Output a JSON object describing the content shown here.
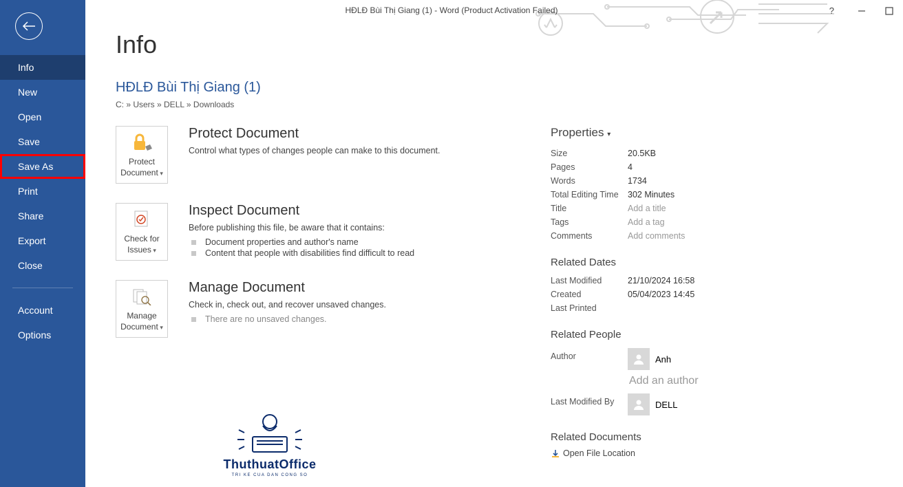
{
  "window": {
    "title": "HĐLĐ Bùi Thị Giang (1) - Word (Product Activation Failed)"
  },
  "sidebar": {
    "items": [
      "Info",
      "New",
      "Open",
      "Save",
      "Save As",
      "Print",
      "Share",
      "Export",
      "Close"
    ],
    "footer": [
      "Account",
      "Options"
    ],
    "active": "Info",
    "highlight": "Save As"
  },
  "page": {
    "title": "Info",
    "doc_title": "HĐLĐ Bùi Thị Giang (1)",
    "doc_path": "C: » Users » DELL » Downloads"
  },
  "sections": {
    "protect": {
      "button": "Protect Document",
      "title": "Protect Document",
      "desc": "Control what types of changes people can make to this document."
    },
    "inspect": {
      "button": "Check for Issues",
      "title": "Inspect Document",
      "desc": "Before publishing this file, be aware that it contains:",
      "items": [
        "Document properties and author's name",
        "Content that people with disabilities find difficult to read"
      ]
    },
    "manage": {
      "button": "Manage Document",
      "title": "Manage Document",
      "desc": "Check in, check out, and recover unsaved changes.",
      "note": "There are no unsaved changes."
    }
  },
  "props": {
    "heading": "Properties",
    "size_k": "Size",
    "size_v": "20.5KB",
    "pages_k": "Pages",
    "pages_v": "4",
    "words_k": "Words",
    "words_v": "1734",
    "edit_k": "Total Editing Time",
    "edit_v": "302 Minutes",
    "title_k": "Title",
    "title_v": "Add a title",
    "tags_k": "Tags",
    "tags_v": "Add a tag",
    "comments_k": "Comments",
    "comments_v": "Add comments",
    "dates_head": "Related Dates",
    "lm_k": "Last Modified",
    "lm_v": "21/10/2024 16:58",
    "cr_k": "Created",
    "cr_v": "05/04/2023 14:45",
    "lp_k": "Last Printed",
    "people_head": "Related People",
    "author_k": "Author",
    "author_v": "Anh",
    "add_author": "Add an author",
    "lmb_k": "Last Modified By",
    "lmb_v": "DELL",
    "docs_head": "Related Documents",
    "open_loc": "Open File Location"
  },
  "watermark": {
    "text": "ThuthuatOffice",
    "sub": "TRI KE CUA DAN CONG SO"
  }
}
